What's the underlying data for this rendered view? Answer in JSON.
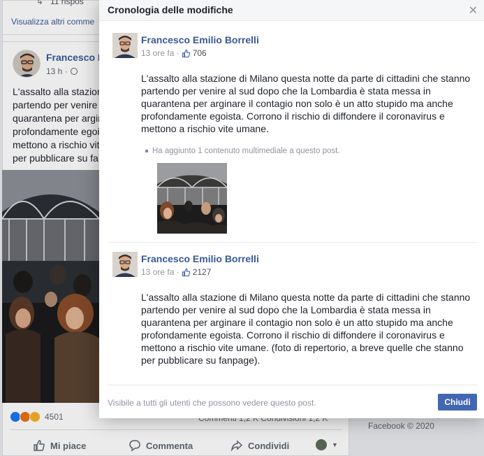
{
  "background": {
    "reply_link": "11 rispos",
    "see_more_comments": "Visualizza altri comme",
    "author": "Francesco E",
    "time": "13 h ·",
    "text_lines": [
      "L'assalto alla stazion",
      "partendo per venire a",
      "quarantena per argin",
      "profondamente egois",
      "mettono a rischio vite",
      "per pubblicare su fan"
    ],
    "reaction_count": "4501",
    "comments_shares": "Commenti 1,2 K  Condivisioni 1,2 K",
    "actions": {
      "like": "Mi piace",
      "comment": "Commenta",
      "share": "Condividi"
    },
    "right_footer": "Facebook © 2020"
  },
  "modal": {
    "title": "Cronologia delle modifiche",
    "close_icon": "close-icon",
    "revisions": [
      {
        "author": "Francesco Emilio Borrelli",
        "time": "13 ore fa ·",
        "likes": "706",
        "text": "L'assalto alla stazione di Milano questa notte da parte di cittadini che stanno partendo per venire al sud dopo che la Lombardia è stata messa in quarantena per arginare il contagio non solo è un atto stupido ma anche profondamente egoista. Corrono il rischio di diffondere il coronavirus e mettono a rischio vite umane.",
        "note": "Ha aggiunto 1 contenuto multimediale a questo post."
      },
      {
        "author": "Francesco Emilio Borrelli",
        "time": "13 ore fa ·",
        "likes": "2127",
        "text": "L'assalto alla stazione di Milano questa notte da parte di cittadini che stanno partendo per venire al sud dopo che la Lombardia è stata messa in quarantena per arginare il contagio non solo è un atto stupido ma anche profondamente egoista. Corrono il rischio di diffondere il coronavirus e mettono a rischio vite umane. (foto di repertorio, a breve quelle che stanno per pubblicare su fanpage)."
      }
    ],
    "footer_note": "Visibile a tutti gli utenti che possono vedere questo post.",
    "close_button": "Chiudi"
  },
  "colors": {
    "link": "#385898",
    "primary_button": "#4267b2",
    "muted": "#90949c"
  }
}
